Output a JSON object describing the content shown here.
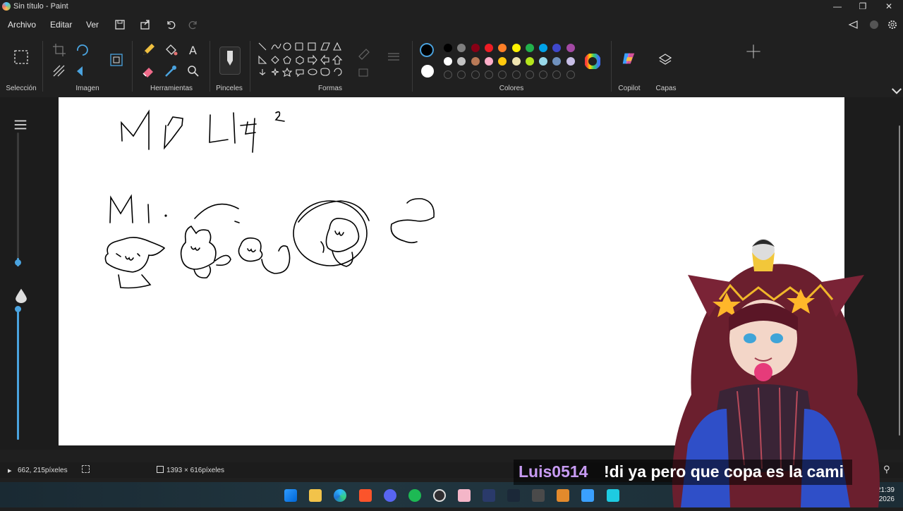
{
  "window": {
    "title": "Sin título - Paint"
  },
  "menu": {
    "items": [
      "Archivo",
      "Editar",
      "Ver"
    ]
  },
  "ribbon": {
    "groups": {
      "seleccion": "Selección",
      "imagen": "Imagen",
      "herramientas": "Herramientas",
      "pinceles": "Pinceles",
      "formas": "Formas",
      "colores": "Colores",
      "copilot": "Copilot",
      "capas": "Capas"
    },
    "palette_row1": [
      "#000000",
      "#7f7f7f",
      "#880015",
      "#ed1c24",
      "#ff7f27",
      "#fff200",
      "#22b14c",
      "#00a2e8",
      "#3f48cc",
      "#a349a4"
    ],
    "palette_row2": [
      "#ffffff",
      "#c3c3c3",
      "#b97a57",
      "#ffaec9",
      "#ffc90e",
      "#efe4b0",
      "#b5e61d",
      "#99d9ea",
      "#7092be",
      "#c8bfe7"
    ]
  },
  "status": {
    "cursor": "662, 215píxeles",
    "canvas_size": "1393 × 616píxeles"
  },
  "chat": {
    "username": "Luis0514",
    "message": "!di ya pero que copa es la cami"
  },
  "clock": {
    "time": "21:39",
    "date": "9/4/2026"
  },
  "accent_color": "#4aa3df"
}
